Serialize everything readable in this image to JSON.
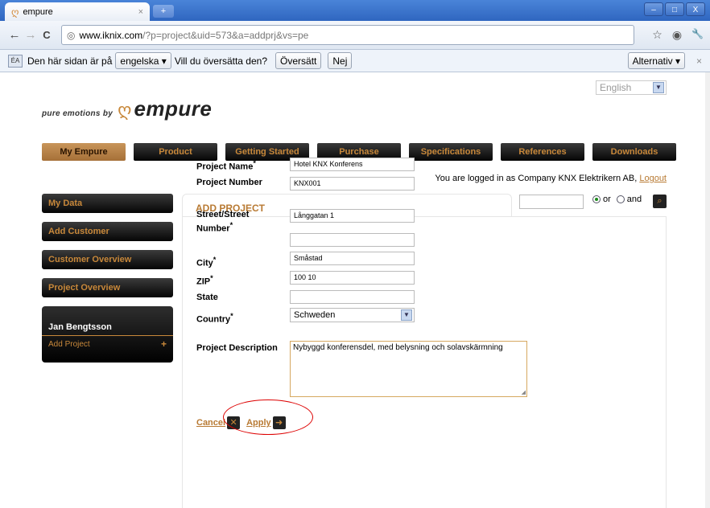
{
  "browser": {
    "tab_title": "empure",
    "tab_close": "×",
    "new_tab": "+",
    "url_host": "www.iknix.com",
    "url_path": "/?p=project&uid=573&a=addprj&vs=pe",
    "back": "←",
    "forward": "→",
    "reload": "C",
    "win_minimize": "–",
    "win_maximize": "□",
    "win_close": "X",
    "star_icon": "☆",
    "wrench_icon": "🔧"
  },
  "translate_bar": {
    "text_before": "Den här sidan är på",
    "language": "engelska ▾",
    "text_after": "Vill du översätta den?",
    "translate_btn": "Översätt",
    "no_btn": "Nej",
    "options_btn": "Alternativ ▾",
    "close": "×"
  },
  "language_select": "English",
  "logo": {
    "tagline": "pure emotions by",
    "brand": "empure"
  },
  "main_nav": [
    {
      "label": "My Empure",
      "active": true
    },
    {
      "label": "Product"
    },
    {
      "label": "Getting Started"
    },
    {
      "label": "Purchase"
    },
    {
      "label": "Specifications"
    },
    {
      "label": "References"
    },
    {
      "label": "Downloads"
    }
  ],
  "login": {
    "text": "You are logged in as Company KNX Elektrikern AB,",
    "logout": "Logout"
  },
  "side_nav": [
    {
      "label": "My Data"
    },
    {
      "label": "Add Customer"
    },
    {
      "label": "Customer Overview"
    },
    {
      "label": "Project Overview"
    }
  ],
  "user_box": {
    "name": "Jan Bengtsson",
    "item": "Add Project",
    "plus": "+"
  },
  "search": {
    "or_label": "or",
    "and_label": "and"
  },
  "form": {
    "heading": "ADD PROJECT",
    "project_name_label": "Project Name",
    "project_name_value": "Hotel KNX Konferens",
    "project_number_label": "Project Number",
    "project_number_value": "KNX001",
    "street_label": "Street/Street Number",
    "street_value": "Långgatan 1",
    "street2_value": "",
    "city_label": "City",
    "city_value": "Småstad",
    "zip_label": "ZIP",
    "zip_value": "100 10",
    "state_label": "State",
    "state_value": "",
    "country_label": "Country",
    "country_value": "Schweden",
    "description_label": "Project Description",
    "description_value": "Nybyggd konferensdel, med belysning och solavskärmning",
    "required_mark": "*",
    "cancel": "Cancel",
    "apply": "Apply"
  }
}
